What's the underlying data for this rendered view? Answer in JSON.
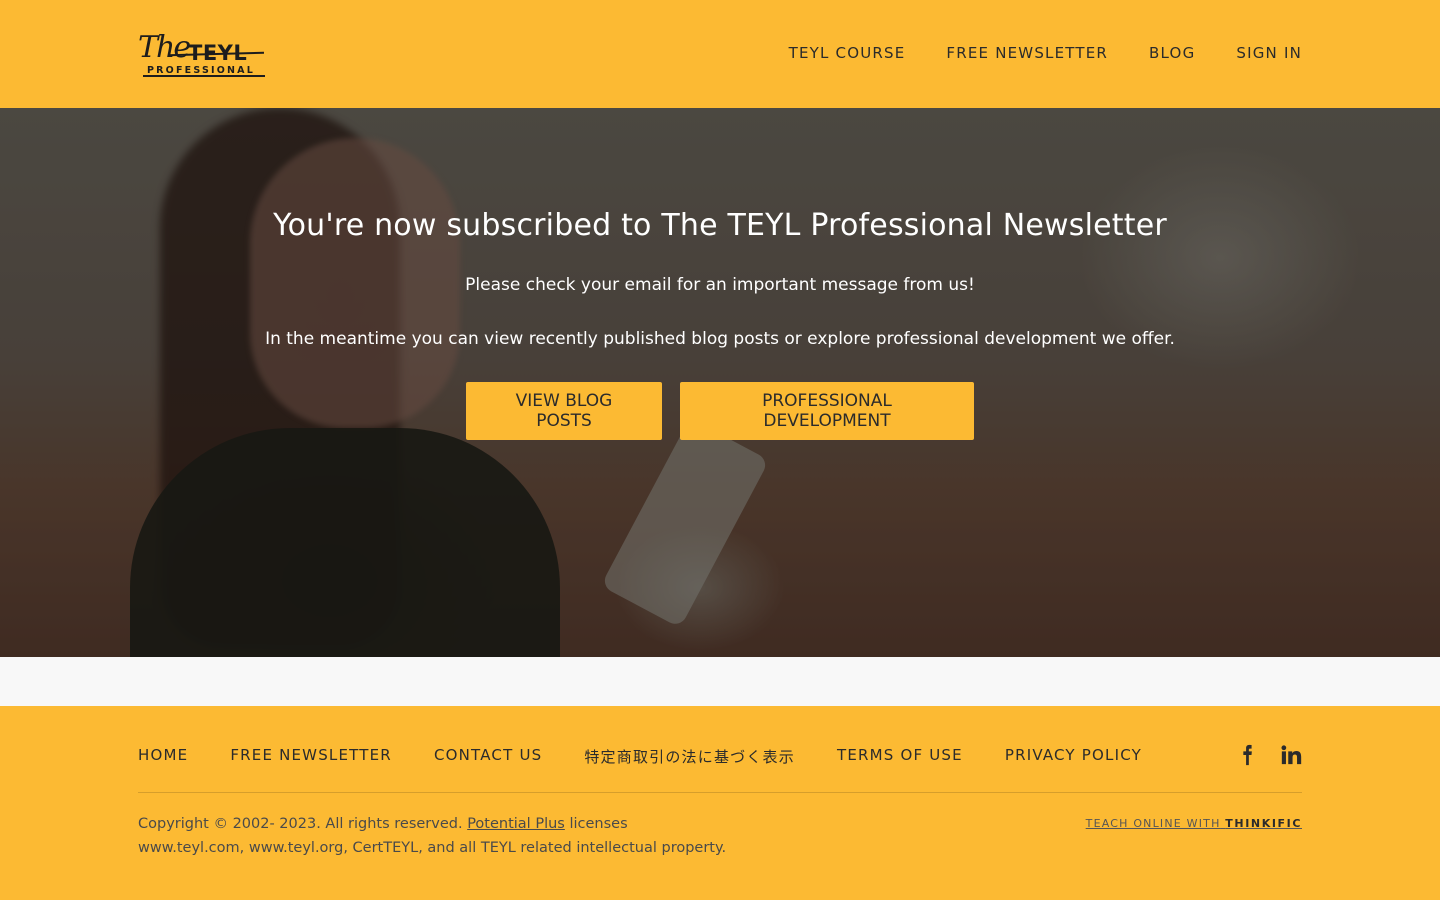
{
  "header": {
    "logo": {
      "script": "The",
      "big": "TEYL",
      "small": "PROFESSIONAL"
    },
    "nav": [
      {
        "label": "TEYL COURSE"
      },
      {
        "label": "FREE NEWSLETTER"
      },
      {
        "label": "BLOG"
      },
      {
        "label": "SIGN IN"
      }
    ]
  },
  "hero": {
    "title": "You're now subscribed to The TEYL Professional Newsletter",
    "message1": "Please check your email for an important message from us!",
    "message2": "In the meantime you can view recently published blog posts or explore professional development we offer.",
    "buttons": {
      "blog": "VIEW BLOG POSTS",
      "pd": "PROFESSIONAL DEVELOPMENT"
    }
  },
  "footer": {
    "nav": [
      {
        "label": "HOME"
      },
      {
        "label": "FREE NEWSLETTER"
      },
      {
        "label": "CONTACT US"
      },
      {
        "label": "特定商取引の法に基づく表示"
      },
      {
        "label": "TERMS OF USE"
      },
      {
        "label": "PRIVACY POLICY"
      }
    ],
    "social": {
      "facebook": "facebook-icon",
      "linkedin": "linkedin-icon"
    },
    "copyright_prefix": "Copyright © 2002- 2023. All rights reserved.",
    "copyright_link": "Potential Plus",
    "copyright_suffix": "licenses www.teyl.com, www.teyl.org, CertTEYL, and all TEYL related intellectual property.",
    "powered_prefix": "TEACH ONLINE WITH",
    "powered_brand": "THINKIFIC"
  },
  "colors": {
    "accent": "#fcba33",
    "text": "#2b2b2b",
    "spacer": "#f8f8f8"
  }
}
